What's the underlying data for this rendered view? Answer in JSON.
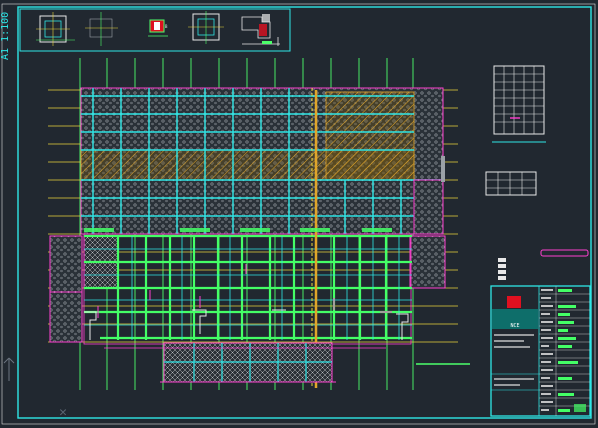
{
  "drawing": {
    "scale_label": "A1 1:100",
    "title_block_company": "NCE",
    "background_color": "#212830",
    "colors": {
      "border": "#2ee6e6",
      "axis": "#e8d33a",
      "grid": "#4cff6a",
      "boundary": "#ff3fd0",
      "hatch": "#d8a020",
      "beam": "#2ee6e6",
      "slab": "#44ff66"
    }
  },
  "icons": {
    "ucs": "ucs-axis-icon",
    "crosshair": "crosshair-icon"
  }
}
